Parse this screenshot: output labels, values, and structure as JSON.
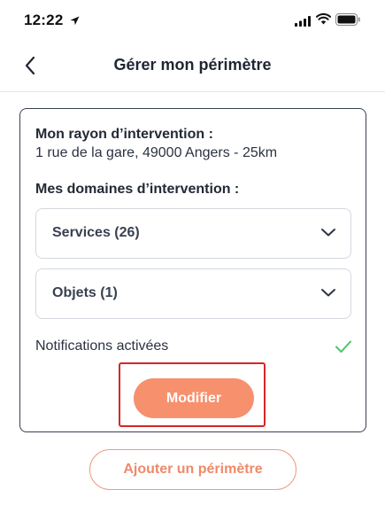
{
  "status_bar": {
    "time": "12:22",
    "icons": [
      "location-arrow-icon",
      "signal-icon",
      "wifi-icon",
      "battery-icon"
    ]
  },
  "nav": {
    "title": "Gérer mon périmètre",
    "back_icon": "chevron-left-icon"
  },
  "card": {
    "radius_label": "Mon rayon d’intervention :",
    "radius_value": "1 rue de la gare, 49000 Angers - 25km",
    "domains_label": "Mes domaines d’intervention :",
    "dropdowns": [
      {
        "label": "Services (26)",
        "icon": "chevron-down-icon"
      },
      {
        "label": "Objets (1)",
        "icon": "chevron-down-icon"
      }
    ],
    "notifications_label": "Notifications activées",
    "notifications_icon": "check-icon",
    "modify_button": "Modifier"
  },
  "add_button": "Ajouter un périmètre",
  "colors": {
    "accent": "#f7906d",
    "accent_outline": "#f19a80",
    "check": "#4cc46a",
    "highlight": "#d62626",
    "text_dark": "#222a36"
  }
}
